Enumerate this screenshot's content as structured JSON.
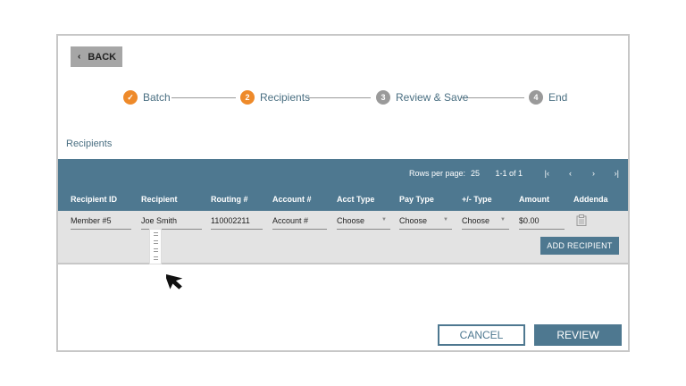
{
  "nav": {
    "back_label": "BACK"
  },
  "stepper": {
    "steps": [
      {
        "number": "✓",
        "label": "Batch",
        "state": "done"
      },
      {
        "number": "2",
        "label": "Recipients",
        "state": "active"
      },
      {
        "number": "3",
        "label": "Review & Save",
        "state": "pending"
      },
      {
        "number": "4",
        "label": "End",
        "state": "pending"
      }
    ]
  },
  "section_title": "Recipients",
  "pager": {
    "rows_per_page_label": "Rows per page:",
    "rows_per_page_value": "25",
    "range": "1-1 of 1",
    "first_icon": "first-page-icon",
    "prev_icon": "chevron-left-icon",
    "next_icon": "chevron-right-icon",
    "last_icon": "last-page-icon"
  },
  "table": {
    "columns": [
      "Recipient ID",
      "Recipient",
      "Routing #",
      "Account #",
      "Acct Type",
      "Pay Type",
      "+/- Type",
      "Amount",
      "Addenda"
    ],
    "row": {
      "recipient_id": "Member #5",
      "recipient": "Joe Smith",
      "routing": "110002211",
      "account_placeholder": "Account #",
      "acct_type": "Choose",
      "pay_type": "Choose",
      "plusminus_type": "Choose",
      "amount": "$0.00",
      "addenda_icon": "clipboard-icon"
    },
    "add_recipient_label": "ADD RECIPIENT"
  },
  "footer": {
    "cancel_label": "CANCEL",
    "review_label": "REVIEW"
  },
  "colors": {
    "accent": "#4e7890",
    "step_active": "#ee8a2a",
    "step_pending": "#9a9a9a"
  }
}
